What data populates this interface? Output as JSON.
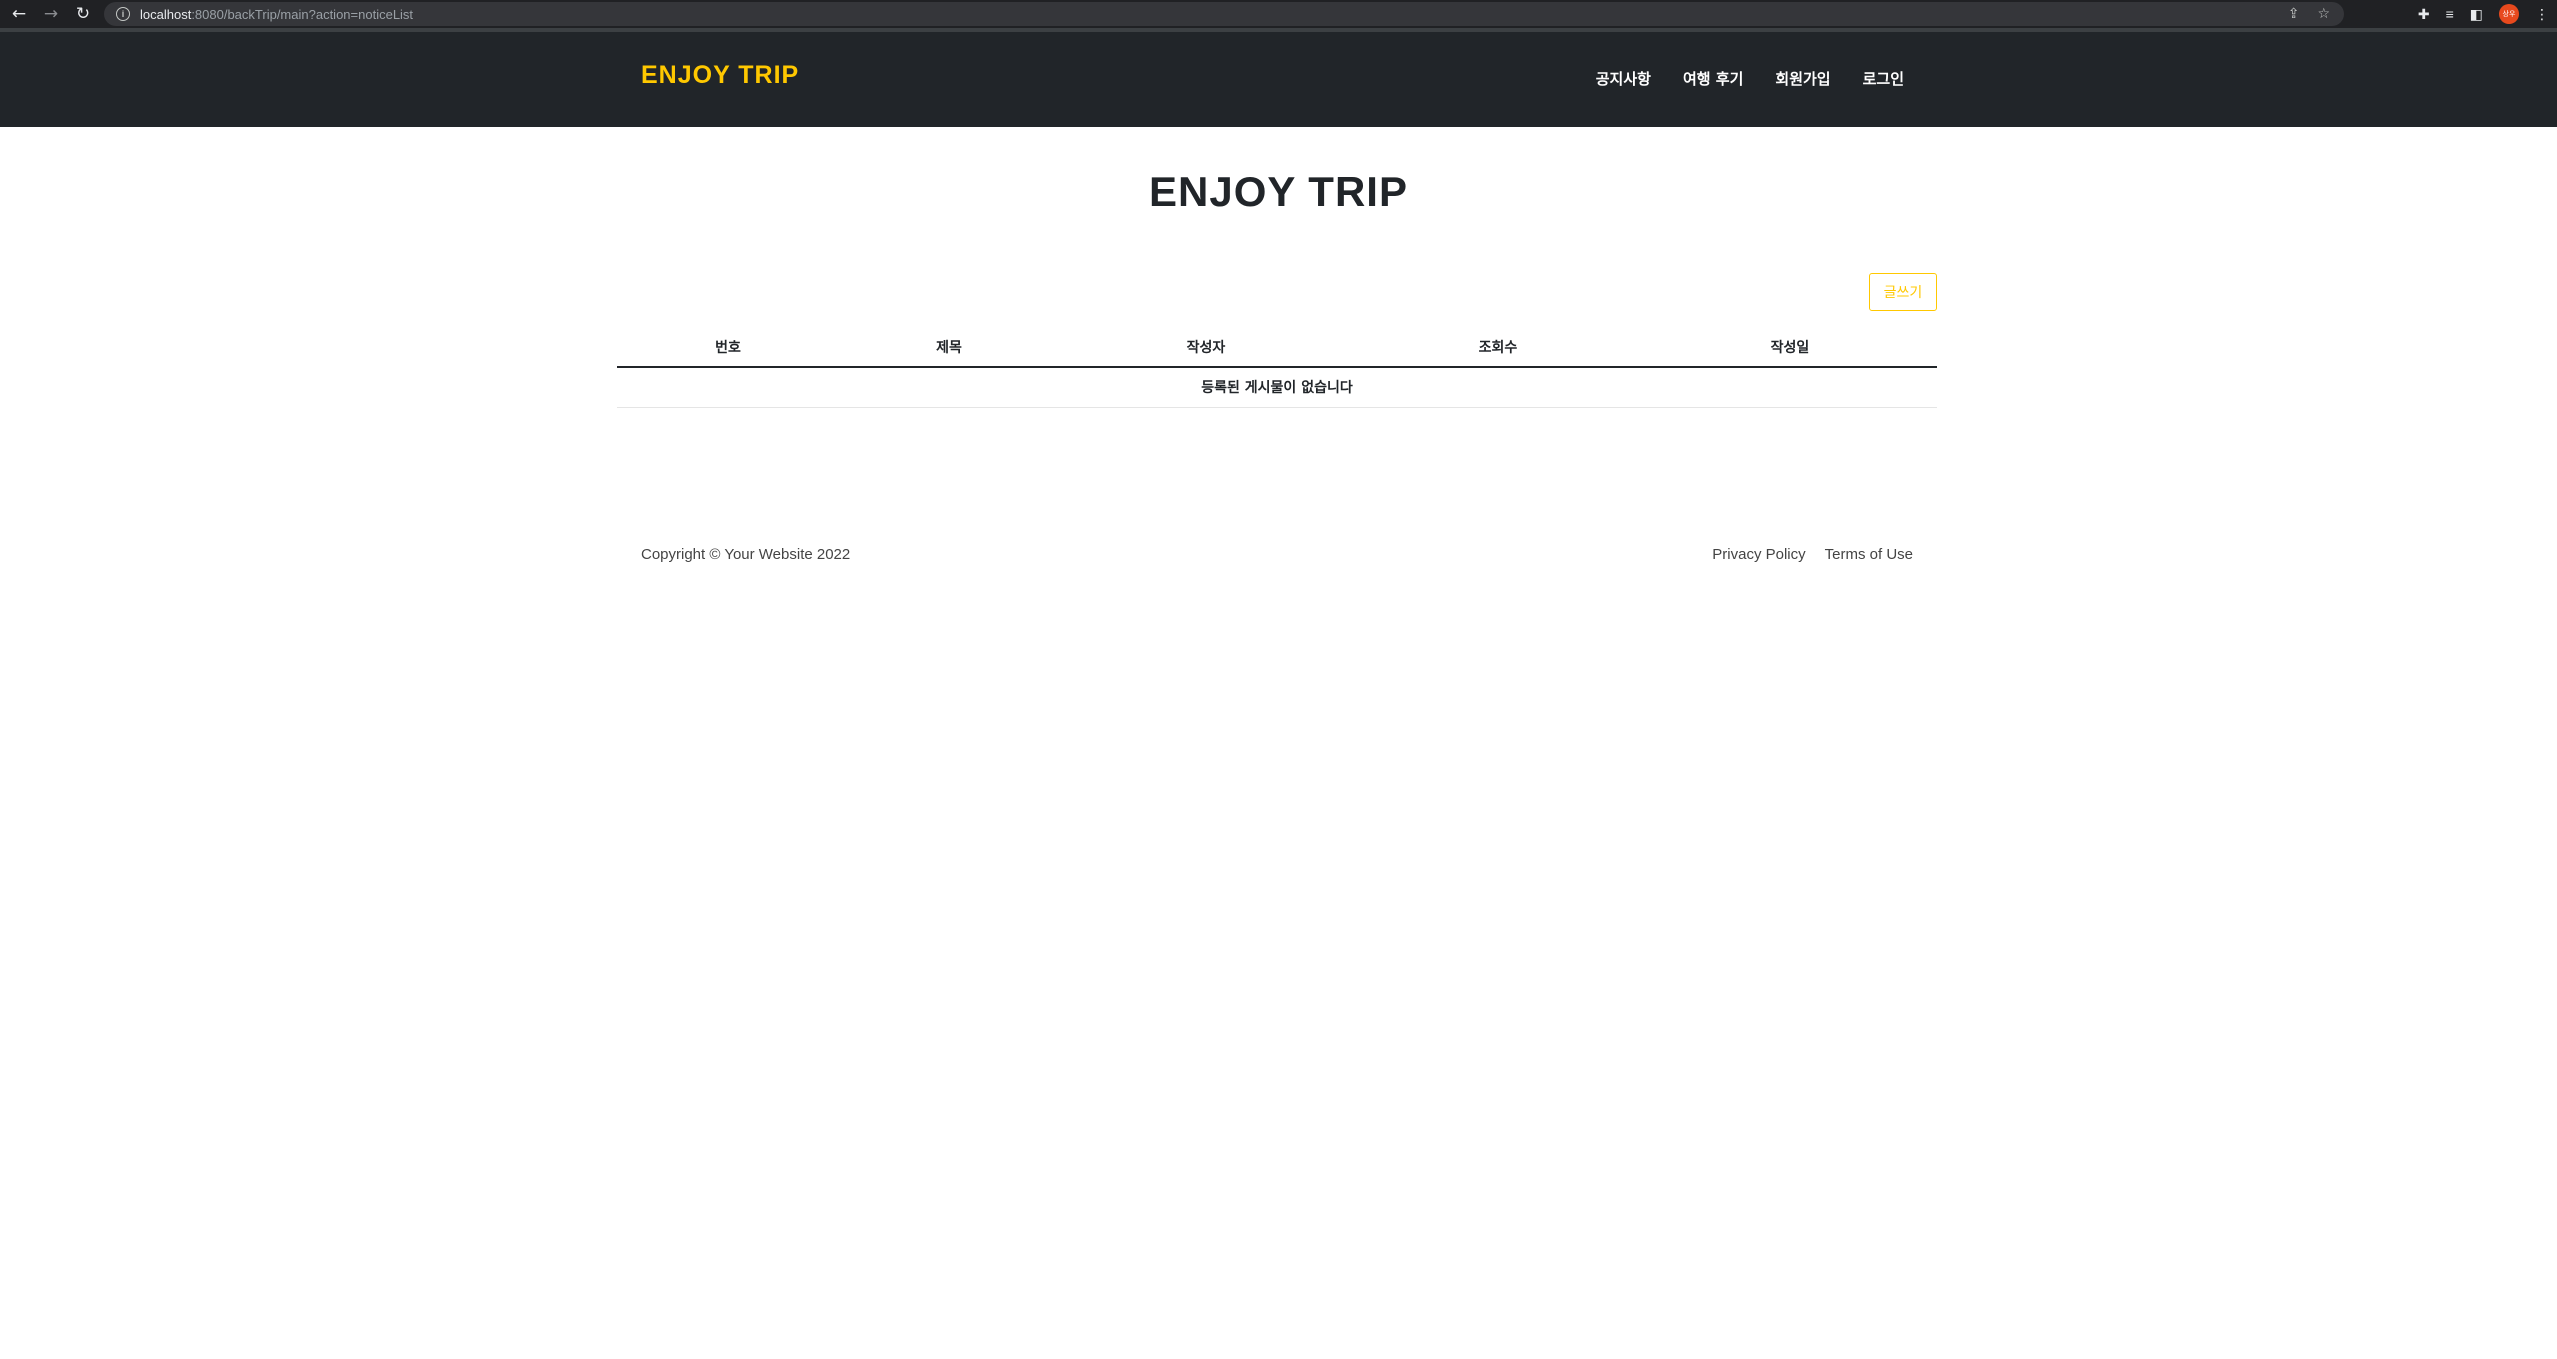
{
  "browser": {
    "back": "←",
    "forward": "→",
    "reload": "↻",
    "info": "i",
    "url_host": "localhost",
    "url_rest": ":8080/backTrip/main?action=noticeList",
    "share": "⇪",
    "bookmark": "☆",
    "extensions": "✚",
    "reading_list": "≡",
    "side_panel": "◧",
    "profile": "상우",
    "menu": "⋮"
  },
  "navbar": {
    "brand": "ENJOY TRIP",
    "menu": [
      {
        "label": "공지사항"
      },
      {
        "label": "여행 후기"
      },
      {
        "label": "회원가입"
      },
      {
        "label": "로그인"
      }
    ]
  },
  "main": {
    "title": "ENJOY TRIP",
    "write_button": "글쓰기",
    "table": {
      "columns": [
        "번호",
        "제목",
        "작성자",
        "조회수",
        "작성일"
      ],
      "empty_message": "등록된 게시물이 없습니다"
    }
  },
  "footer": {
    "copyright": "Copyright © Your Website 2022",
    "privacy": "Privacy Policy",
    "terms": "Terms of Use"
  },
  "colors": {
    "accent": "#ffc800",
    "nav_bg": "#212529"
  }
}
